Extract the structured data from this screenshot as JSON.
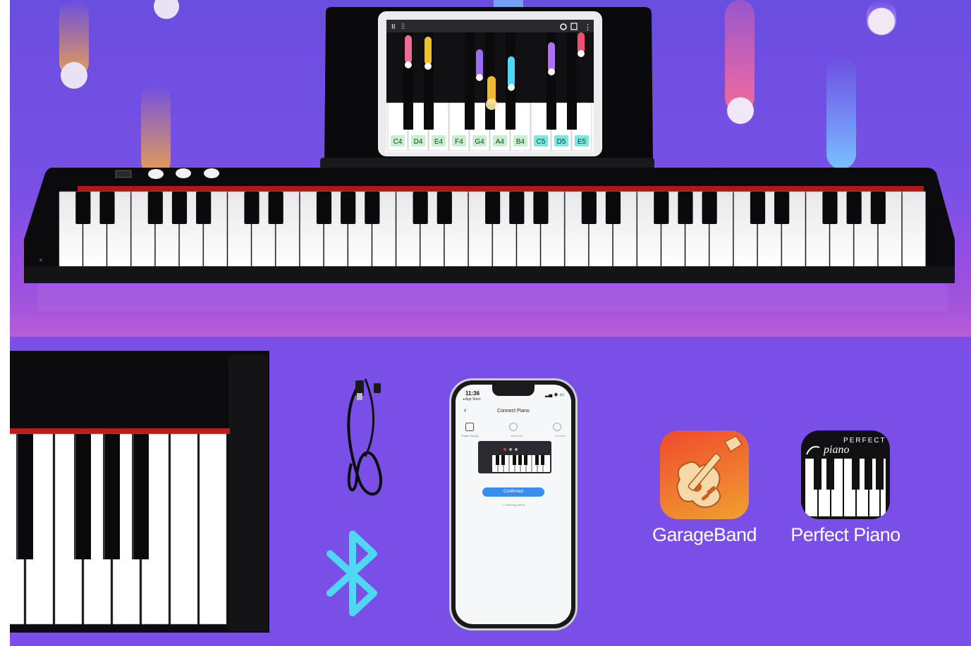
{
  "tablet": {
    "notes": [
      "C4",
      "D4",
      "E4",
      "F4",
      "G4",
      "A4",
      "B4",
      "C5",
      "D5",
      "E5"
    ],
    "highlighted_notes": [
      "C5",
      "D5",
      "E5"
    ]
  },
  "phone": {
    "time": "11:36",
    "back_link": "◂ App Store",
    "title": "Connect Piano",
    "steps": [
      "Power Supply",
      "Bluetooth",
      "Connect"
    ],
    "confirm_label": "Confirmed",
    "teaching_link": "Teaching videos"
  },
  "apps": [
    {
      "name": "GarageBand",
      "icon": "garageband-guitar-icon"
    },
    {
      "name": "Perfect Piano",
      "icon": "perfect-piano-icon",
      "icon_text": "PERFECT piano"
    }
  ],
  "colors": {
    "background_purple": "#7a4fe8",
    "bluetooth": "#4fd8f4",
    "confirm_button": "#3b8cf0"
  }
}
